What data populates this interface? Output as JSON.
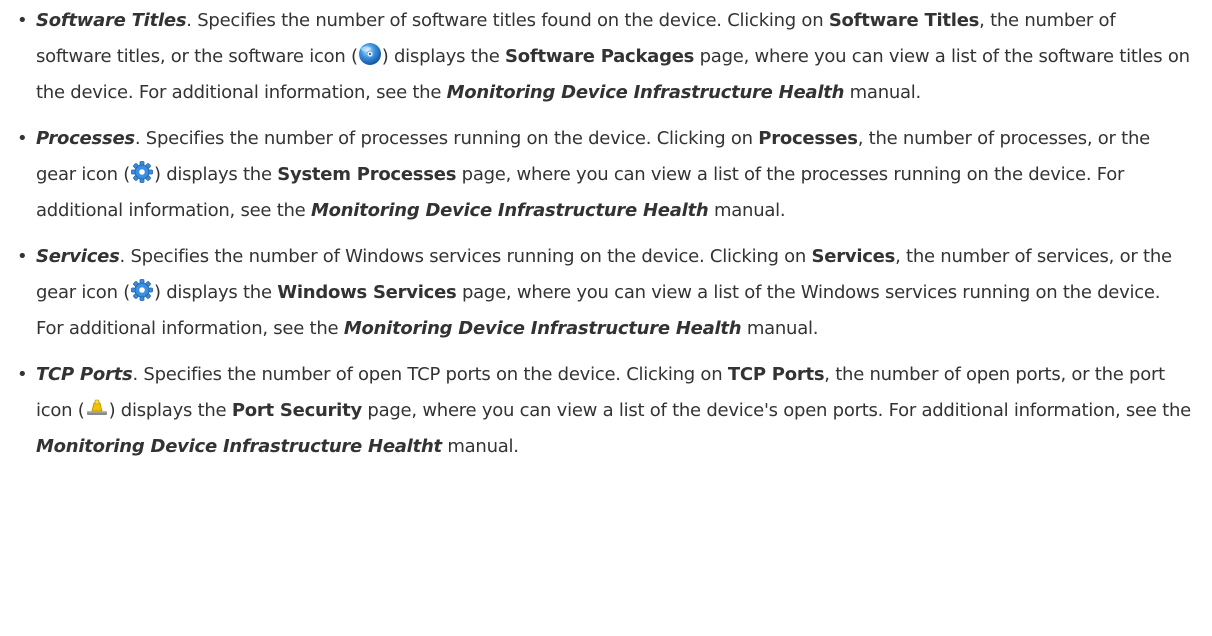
{
  "items": [
    {
      "term": "Software Titles",
      "t1": ". Specifies the number of software titles found on the device. Clicking on ",
      "ui1": "Software Titles",
      "t2": ", the number of software titles, or the software icon (",
      "icon": "software-disc-icon",
      "t3": ") displays the ",
      "ui2": "Software Packages",
      "t4": " page, where you can view a list of the software titles on the device. For additional information, see the ",
      "manual": "Monitoring Device Infrastructure Health",
      "t5": " manual."
    },
    {
      "term": "Processes",
      "t1": ". Specifies the number of processes running on the device. Clicking on ",
      "ui1": "Processes",
      "t2": ", the number of processes, or the gear icon (",
      "icon": "gear-icon",
      "t3": ") displays the ",
      "ui2": "System Processes",
      "t4": " page, where you can view a list of the processes running on the device. For additional information, see the ",
      "manual": "Monitoring Device Infrastructure Health",
      "t5": " manual."
    },
    {
      "term": "Services",
      "t1": ". Specifies the number of Windows services running on the device. Clicking on ",
      "ui1": "Services",
      "t2": ", the number of services, or the gear icon (",
      "icon": "gear-icon",
      "t3": ") displays the ",
      "ui2": "Windows Services",
      "t4": " page, where you can view a list of the Windows services running on the device. For additional information, see the ",
      "manual": "Monitoring Device Infrastructure Health",
      "t5": " manual."
    },
    {
      "term": "TCP Ports",
      "t1": ". Specifies the number of open TCP ports on the device. Clicking on ",
      "ui1": "TCP Ports",
      "t2": ", the number of open ports, or the port icon (",
      "icon": "port-icon",
      "t3": ") displays the ",
      "ui2": "Port Security",
      "t4": " page, where you can view a list of the device's open ports. For additional information, see the ",
      "manual": "Monitoring Device Infrastructure Healtht",
      "t5": " manual."
    }
  ],
  "colors": {
    "text": "#333333",
    "disc_blue": "#2a7fd4",
    "gear_blue": "#3b8fe0",
    "port_yellow": "#f2c200"
  }
}
